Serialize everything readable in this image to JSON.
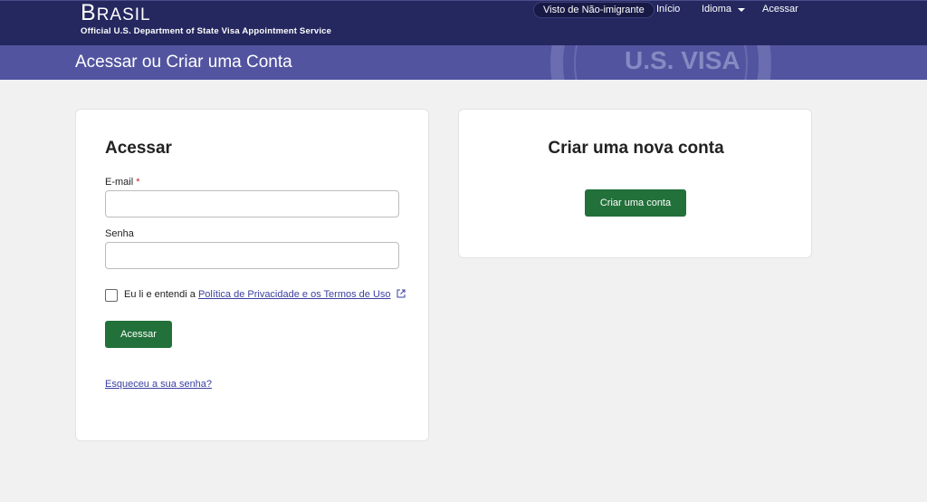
{
  "header": {
    "brand": "Brasil",
    "subtitle": "Official U.S. Department of State Visa Appointment Service",
    "visa_type": "Visto de Não-imigrante",
    "nav_inicio": "Início",
    "nav_idioma": "Idioma",
    "nav_acessar": "Acessar"
  },
  "banner": {
    "title": "Acessar ou Criar uma Conta",
    "seal_text": "U.S. VISA"
  },
  "login": {
    "heading": "Acessar",
    "email_label": "E-mail",
    "required_mark": "*",
    "email_value": "",
    "password_label": "Senha",
    "password_value": "",
    "terms_prefix": "Eu li e entendi a",
    "terms_link": "Política de Privacidade e os Termos de Uso",
    "submit_label": "Acessar",
    "forgot_link": "Esqueceu a sua senha?"
  },
  "signup": {
    "heading": "Criar uma nova conta",
    "button_label": "Criar uma conta"
  },
  "colors": {
    "topbar": "#25285f",
    "banner": "#5254a0",
    "button_green": "#22703a",
    "link": "#3b3fa0"
  }
}
